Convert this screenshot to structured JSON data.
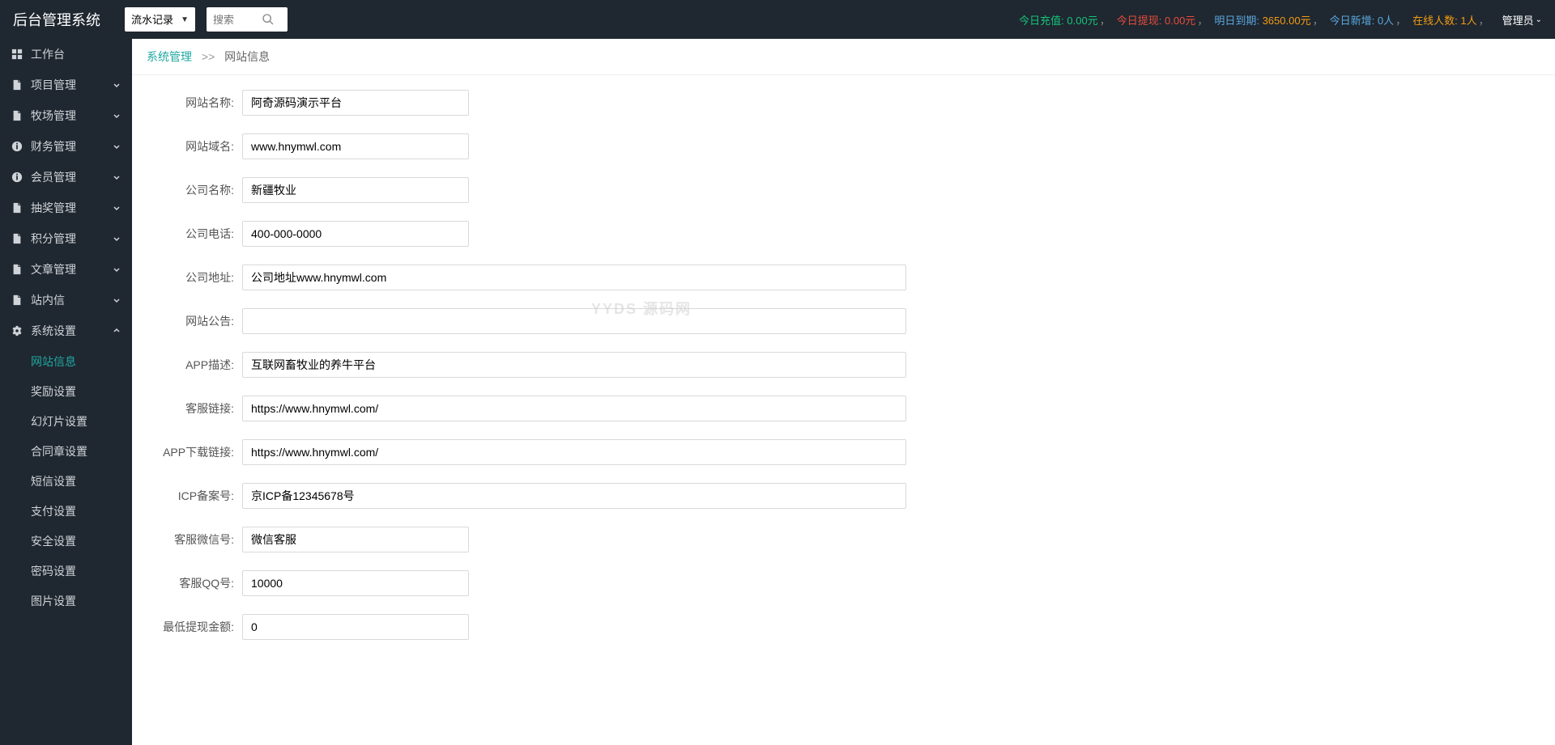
{
  "header": {
    "logo": "后台管理系统",
    "select_value": "流水记录",
    "search_placeholder": "搜索",
    "stats": [
      {
        "label": "今日充值:",
        "value": "0.00元",
        "labelColor": "green",
        "valueColor": "green"
      },
      {
        "label": "今日提现:",
        "value": "0.00元",
        "labelColor": "red",
        "valueColor": "red"
      },
      {
        "label": "明日到期:",
        "value": "3650.00元",
        "labelColor": "blue",
        "valueColor": "orange"
      },
      {
        "label": "今日新增:",
        "value": "0人",
        "labelColor": "blue",
        "valueColor": "blue"
      },
      {
        "label": "在线人数:",
        "value": "1人",
        "labelColor": "orange",
        "valueColor": "orange"
      }
    ],
    "admin": "管理员"
  },
  "sidebar": {
    "items": [
      {
        "icon": "dashboard",
        "label": "工作台",
        "expandable": false
      },
      {
        "icon": "doc",
        "label": "项目管理",
        "expandable": true
      },
      {
        "icon": "doc",
        "label": "牧场管理",
        "expandable": true
      },
      {
        "icon": "info",
        "label": "财务管理",
        "expandable": true
      },
      {
        "icon": "info",
        "label": "会员管理",
        "expandable": true
      },
      {
        "icon": "doc",
        "label": "抽奖管理",
        "expandable": true
      },
      {
        "icon": "doc",
        "label": "积分管理",
        "expandable": true
      },
      {
        "icon": "doc",
        "label": "文章管理",
        "expandable": true
      },
      {
        "icon": "doc",
        "label": "站内信",
        "expandable": true
      },
      {
        "icon": "gear",
        "label": "系统设置",
        "expandable": true,
        "expanded": true
      }
    ],
    "sub_items": [
      {
        "label": "网站信息",
        "active": true
      },
      {
        "label": "奖励设置"
      },
      {
        "label": "幻灯片设置"
      },
      {
        "label": "合同章设置"
      },
      {
        "label": "短信设置"
      },
      {
        "label": "支付设置"
      },
      {
        "label": "安全设置"
      },
      {
        "label": "密码设置"
      },
      {
        "label": "图片设置"
      }
    ]
  },
  "breadcrumb": {
    "link": "系统管理",
    "sep": ">>",
    "current": "网站信息"
  },
  "form": {
    "fields": [
      {
        "label": "网站名称:",
        "value": "阿奇源码演示平台",
        "size": "short"
      },
      {
        "label": "网站域名:",
        "value": "www.hnymwl.com",
        "size": "short"
      },
      {
        "label": "公司名称:",
        "value": "新疆牧业",
        "size": "short"
      },
      {
        "label": "公司电话:",
        "value": "400-000-0000",
        "size": "short"
      },
      {
        "label": "公司地址:",
        "value": "公司地址www.hnymwl.com",
        "size": "long"
      },
      {
        "label": "网站公告:",
        "value": "",
        "size": "long"
      },
      {
        "label": "APP描述:",
        "value": "互联网畜牧业的养牛平台",
        "size": "long"
      },
      {
        "label": "客服链接:",
        "value": "https://www.hnymwl.com/",
        "size": "long"
      },
      {
        "label": "APP下载链接:",
        "value": "https://www.hnymwl.com/",
        "size": "long"
      },
      {
        "label": "ICP备案号:",
        "value": "京ICP备12345678号",
        "size": "long"
      },
      {
        "label": "客服微信号:",
        "value": "微信客服",
        "size": "short"
      },
      {
        "label": "客服QQ号:",
        "value": "10000",
        "size": "short"
      },
      {
        "label": "最低提现金额:",
        "value": "0",
        "size": "short"
      }
    ]
  },
  "watermark": "YYDS 源码网"
}
